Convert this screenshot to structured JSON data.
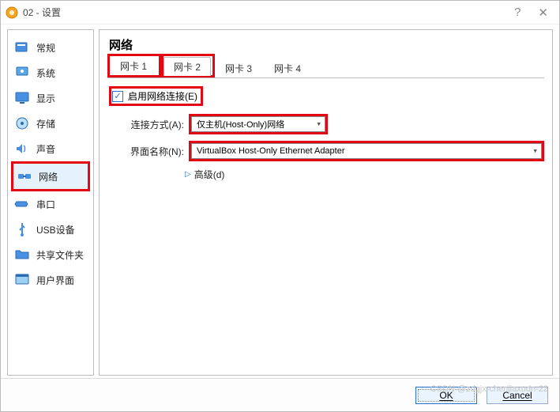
{
  "window": {
    "title": "02 - 设置"
  },
  "sidebar": {
    "items": [
      {
        "label": "常规"
      },
      {
        "label": "系统"
      },
      {
        "label": "显示"
      },
      {
        "label": "存储"
      },
      {
        "label": "声音"
      },
      {
        "label": "网络"
      },
      {
        "label": "串口"
      },
      {
        "label": "USB设备"
      },
      {
        "label": "共享文件夹"
      },
      {
        "label": "用户界面"
      }
    ],
    "highlighted_index": 5
  },
  "main": {
    "heading": "网络",
    "tabs": [
      {
        "label": "网卡 1",
        "active": false
      },
      {
        "label": "网卡 2",
        "active": true
      },
      {
        "label": "网卡 3",
        "active": false
      },
      {
        "label": "网卡 4",
        "active": false
      }
    ],
    "enable_checkbox": {
      "checked": true,
      "label": "启用网络连接(E)"
    },
    "attach_label": "连接方式(A):",
    "attach_value": "仅主机(Host-Only)网络",
    "name_label": "界面名称(N):",
    "name_value": "VirtualBox Host-Only Ethernet Adapter",
    "advanced_label": "高级(d)"
  },
  "footer": {
    "ok": "OK",
    "cancel": "Cancel"
  },
  "watermark": "CSDN @zdgjx-chenjiaxudn-22",
  "colors": {
    "highlight": "#e30613",
    "accent": "#2a72d4",
    "selected_bg": "#e5f1fb"
  }
}
